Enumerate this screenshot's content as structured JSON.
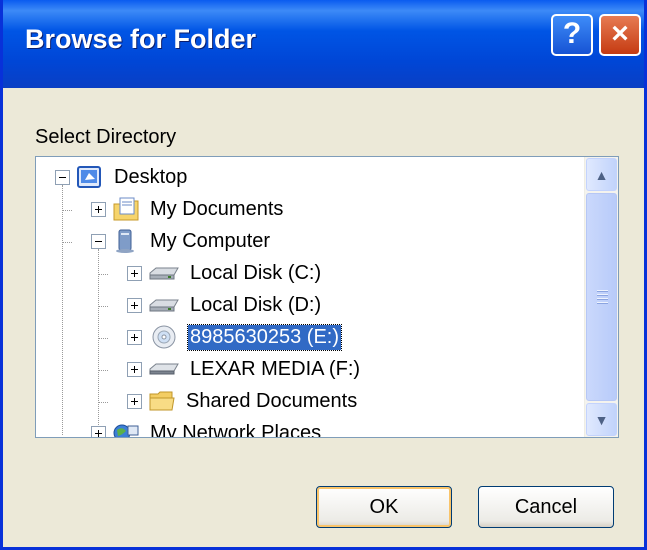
{
  "dialog": {
    "title": "Browse for Folder",
    "help_glyph": "?",
    "close_glyph": "×",
    "prompt": "Select Directory"
  },
  "tree": {
    "nodes": [
      {
        "label": "Desktop",
        "icon": "desktop-icon",
        "expander": "minus"
      },
      {
        "label": "My Documents",
        "icon": "my-documents-icon",
        "expander": "plus"
      },
      {
        "label": "My Computer",
        "icon": "my-computer-icon",
        "expander": "minus"
      },
      {
        "label": "Local Disk (C:)",
        "icon": "hard-drive-icon",
        "expander": "plus"
      },
      {
        "label": "Local Disk (D:)",
        "icon": "hard-drive-icon",
        "expander": "plus"
      },
      {
        "label": "8985630253 (E:)",
        "icon": "cd-drive-icon",
        "expander": "plus",
        "selected": true
      },
      {
        "label": "LEXAR MEDIA (F:)",
        "icon": "removable-drive-icon",
        "expander": "plus"
      },
      {
        "label": "Shared Documents",
        "icon": "folder-icon",
        "expander": "plus"
      },
      {
        "label": "My Network Places",
        "icon": "network-places-icon",
        "expander": "plus"
      }
    ]
  },
  "scrollbar": {
    "up_glyph": "▲",
    "down_glyph": "▼"
  },
  "buttons": {
    "ok": "OK",
    "cancel": "Cancel"
  },
  "colors": {
    "titlebar": "#0055e5",
    "selection": "#316ac5",
    "dialog_bg": "#ece9d8"
  }
}
